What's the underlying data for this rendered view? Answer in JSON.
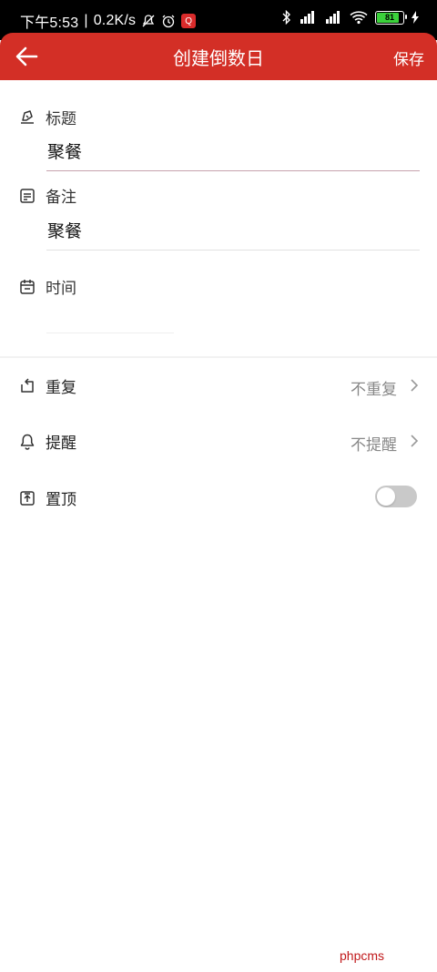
{
  "status_bar": {
    "time": "下午5:53",
    "network_speed": "0.2K/s",
    "battery_level": "81"
  },
  "header": {
    "title": "创建倒数日",
    "save_label": "保存",
    "color": "#d32f26"
  },
  "form": {
    "title_label": "标题",
    "title_value": "聚餐",
    "note_label": "备注",
    "note_value": "聚餐",
    "time_label": "时间"
  },
  "options": {
    "repeat_label": "重复",
    "repeat_value": "不重复",
    "reminder_label": "提醒",
    "reminder_value": "不提醒",
    "pin_label": "置顶",
    "pin_enabled": false
  },
  "watermark": "phpcms"
}
